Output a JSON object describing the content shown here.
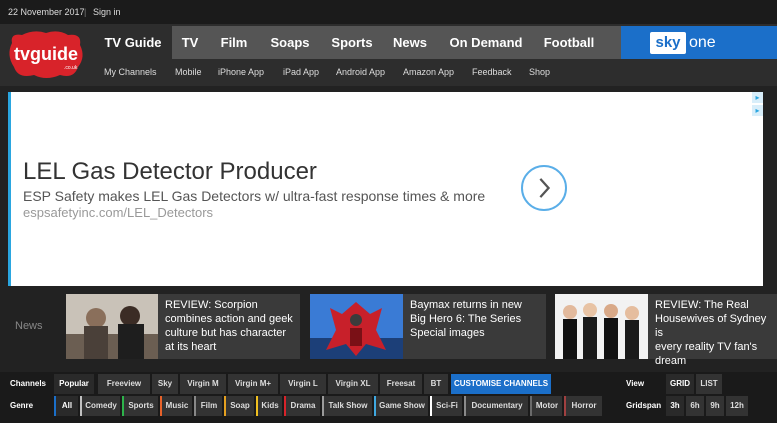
{
  "topbar": {
    "date": "22 November 2017",
    "separator": "|",
    "signin": "Sign in"
  },
  "logo": {
    "text": "tvguide",
    "sub": ".co.uk"
  },
  "mainnav": [
    "TV Guide",
    "TV",
    "Film",
    "Soaps",
    "Sports",
    "News",
    "On Demand",
    "Football"
  ],
  "sky": {
    "sky": "sky",
    "one": "one"
  },
  "subnav": [
    "My Channels",
    "Mobile",
    "iPhone App",
    "iPad App",
    "Android App",
    "Amazon App",
    "Feedback",
    "Shop"
  ],
  "ad": {
    "headline": "LEL Gas Detector Producer",
    "desc": "ESP Safety makes LEL Gas Detectors w/ ultra-fast response times & more",
    "url": "espsafetyinc.com/LEL_Detectors"
  },
  "news": {
    "label": "News",
    "items": [
      {
        "lines": [
          "REVIEW: Scorpion",
          "combines action and geek",
          "culture but has character",
          "at its heart"
        ]
      },
      {
        "lines": [
          "Baymax returns in new",
          "Big Hero 6: The Series",
          "Special images"
        ]
      },
      {
        "lines": [
          "REVIEW: The Real",
          "Housewives of Sydney is",
          "every reality TV fan's",
          "dream"
        ]
      }
    ]
  },
  "channels": {
    "label": "Channels",
    "items": [
      "Popular",
      "Freeview",
      "Sky",
      "Virgin M",
      "Virgin M+",
      "Virgin L",
      "Virgin XL",
      "Freesat",
      "BT"
    ],
    "customise": "CUSTOMISE CHANNELS"
  },
  "genre": {
    "label": "Genre",
    "items": [
      "All",
      "Comedy",
      "Sports",
      "Music",
      "Film",
      "Soap",
      "Kids",
      "Drama",
      "Talk Show",
      "Game Show",
      "Sci-Fi",
      "Documentary",
      "Motor",
      "Horror"
    ]
  },
  "view": {
    "label": "View",
    "items": [
      "GRID",
      "LIST"
    ]
  },
  "gridspan": {
    "label": "Gridspan",
    "items": [
      "3h",
      "6h",
      "9h",
      "12h"
    ]
  },
  "colors": {
    "accent": "#1b6fc9",
    "logo_red": "#d8232a",
    "ad_border": "#2aa6e0"
  }
}
